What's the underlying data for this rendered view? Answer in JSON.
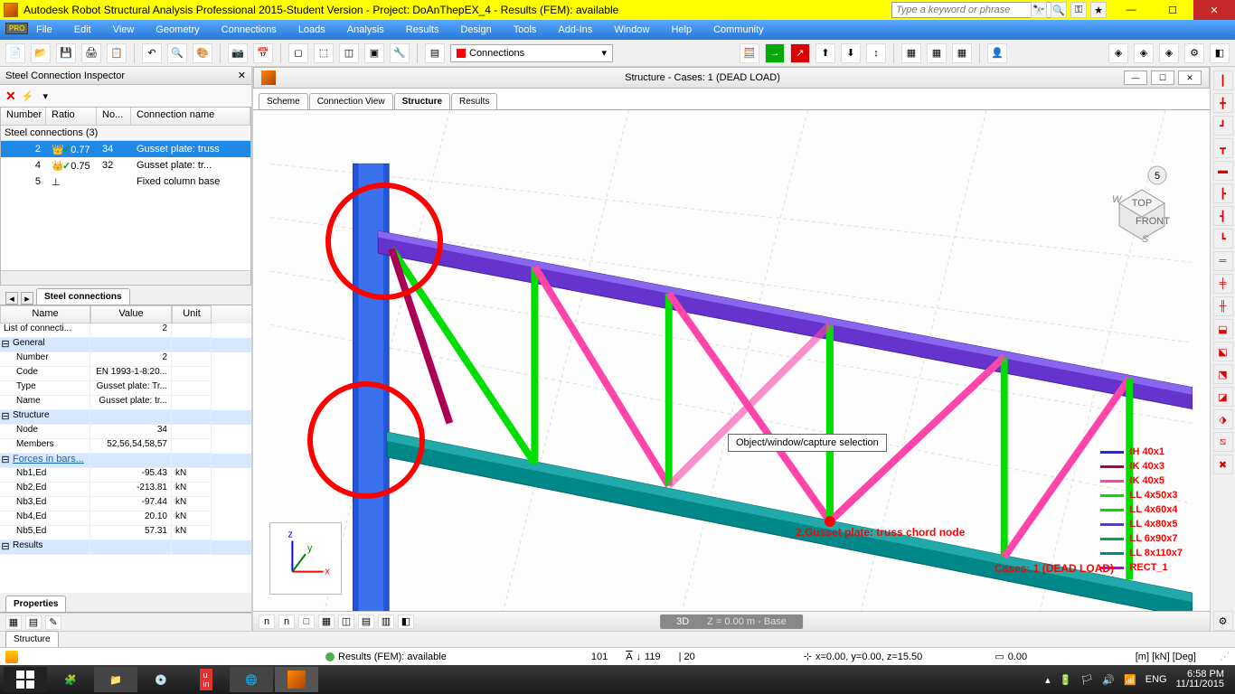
{
  "titlebar": {
    "text": "Autodesk Robot Structural Analysis Professional 2015-Student Version - Project: DoAnThepEX_4 - Results (FEM): available",
    "search_placeholder": "Type a keyword or phrase"
  },
  "menubar": [
    "File",
    "Edit",
    "View",
    "Geometry",
    "Connections",
    "Loads",
    "Analysis",
    "Results",
    "Design",
    "Tools",
    "Add-Ins",
    "Window",
    "Help",
    "Community"
  ],
  "toolbar_dropdown": "Connections",
  "inspector": {
    "title": "Steel Connection Inspector",
    "columns": [
      "Number",
      "Ratio",
      "No...",
      "Connection name"
    ],
    "group": "Steel connections (3)",
    "rows": [
      {
        "num": "2",
        "ratio": "0.77",
        "no": "34",
        "name": "Gusset plate: truss",
        "selected": true,
        "has_ratio": true
      },
      {
        "num": "4",
        "ratio": "0.75",
        "no": "32",
        "name": "Gusset plate: tr...",
        "selected": false,
        "has_ratio": true
      },
      {
        "num": "5",
        "ratio": "",
        "no": "",
        "name": "Fixed column base",
        "selected": false,
        "has_ratio": false
      }
    ],
    "tab": "Steel connections"
  },
  "props": {
    "columns": [
      "Name",
      "Value",
      "Unit"
    ],
    "rows": [
      {
        "name": "List of connecti...",
        "val": "2",
        "unit": "",
        "group": false
      },
      {
        "name": "General",
        "val": "",
        "unit": "",
        "group": true
      },
      {
        "name": "Number",
        "val": "2",
        "unit": "",
        "indent": true
      },
      {
        "name": "Code",
        "val": "EN 1993-1-8:20...",
        "unit": "",
        "indent": true
      },
      {
        "name": "Type",
        "val": "Gusset plate: Tr...",
        "unit": "",
        "indent": true
      },
      {
        "name": "Name",
        "val": "Gusset plate: tr...",
        "unit": "",
        "indent": true
      },
      {
        "name": "Structure",
        "val": "",
        "unit": "",
        "group": true
      },
      {
        "name": "Node",
        "val": "34",
        "unit": "",
        "indent": true
      },
      {
        "name": "Members",
        "val": "52,56,54,58,57",
        "unit": "",
        "indent": true
      },
      {
        "name": "Forces in bars...",
        "val": "",
        "unit": "",
        "group": true,
        "link": true
      },
      {
        "name": "Nb1,Ed",
        "val": "-95.43",
        "unit": "kN",
        "indent": true
      },
      {
        "name": "Nb2,Ed",
        "val": "-213.81",
        "unit": "kN",
        "indent": true
      },
      {
        "name": "Nb3,Ed",
        "val": "-97.44",
        "unit": "kN",
        "indent": true
      },
      {
        "name": "Nb4,Ed",
        "val": "20.10",
        "unit": "kN",
        "indent": true
      },
      {
        "name": "Nb5,Ed",
        "val": "57.31",
        "unit": "kN",
        "indent": true
      },
      {
        "name": "Results",
        "val": "",
        "unit": "",
        "group": true
      }
    ],
    "tab": "Properties"
  },
  "structure_tab": "Structure",
  "viewport": {
    "title": "Structure - Cases: 1 (DEAD LOAD)",
    "tabs": [
      "Scheme",
      "Connection View",
      "Structure",
      "Results"
    ],
    "active_tab": "Structure",
    "tooltip": "Object/window/capture selection",
    "cube_num": "5",
    "cube_faces": {
      "top": "TOP",
      "front": "FRONT",
      "s": "S",
      "w": "W"
    },
    "legend": [
      {
        "c": "#2222ff",
        "t": "IH 40x1"
      },
      {
        "c": "#aa0055",
        "t": "IK 40x3"
      },
      {
        "c": "#ff44aa",
        "t": "IK 40x5"
      },
      {
        "c": "#00dd00",
        "t": "LL 4x50x3"
      },
      {
        "c": "#00dd00",
        "t": "LL 4x60x4"
      },
      {
        "c": "#5533ff",
        "t": "LL 4x80x5"
      },
      {
        "c": "#00aa44",
        "t": "LL 6x90x7"
      },
      {
        "c": "#008888",
        "t": "LL 8x110x7"
      },
      {
        "c": "#cc00cc",
        "t": "RECT_1"
      }
    ],
    "anno1": "2,Gusset plate: truss chord node",
    "anno2": "Cases: 1 (DEAD LOAD)",
    "viewbar_3d": "3D",
    "viewbar_z": "Z = 0.00 m - Base"
  },
  "status": {
    "results": "Results (FEM): available",
    "s1": "101",
    "s2": "119",
    "s3": "| 20",
    "coords": "x=0.00, y=0.00, z=15.50",
    "zero": "0.00",
    "units": "[m] [kN] [Deg]"
  },
  "taskbar": {
    "lang": "ENG",
    "time": "6:58 PM",
    "date": "11/11/2015"
  }
}
